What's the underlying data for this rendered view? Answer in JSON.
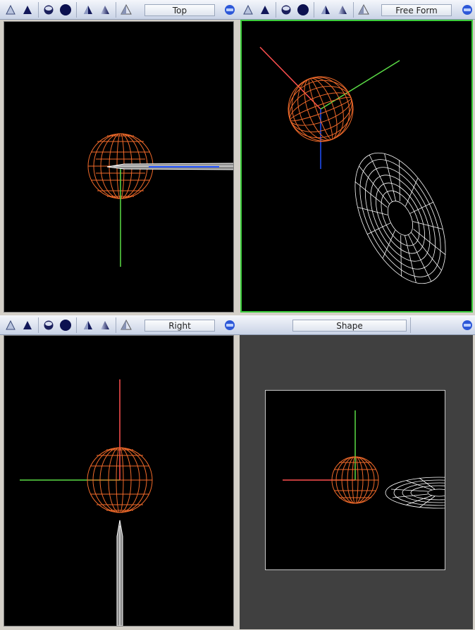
{
  "panes": {
    "top": {
      "label": "Top"
    },
    "free": {
      "label": "Free Form"
    },
    "right": {
      "label": "Right"
    },
    "shape": {
      "label": "Shape"
    }
  },
  "toolbar_icons": [
    "wireframe-cone-icon",
    "solid-cone-icon",
    "wireframe-sphere-icon",
    "solid-sphere-icon",
    "flat-shade-icon",
    "smooth-shade-icon",
    "transparent-cone-icon",
    "camera-reset-icon"
  ],
  "colors": {
    "active_border": "#3ccd3c",
    "sphere": "#f06a2a",
    "axis_x": "#ff5050",
    "axis_y": "#5adc46",
    "axis_z": "#2050ff",
    "torus": "#ffffff"
  }
}
